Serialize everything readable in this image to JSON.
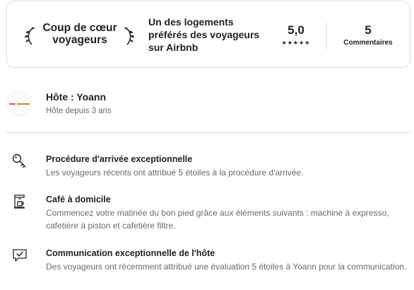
{
  "guest_favorite": {
    "title": "Coup de cœur voyageurs",
    "description": "Un des logements préférés des voyageurs sur Airbnb",
    "rating": "5,0",
    "stars": "★★★★★",
    "reviews_count": "5",
    "reviews_label": "Commentaires"
  },
  "host": {
    "name": "Hôte : Yoann",
    "since": "Hôte depuis 3 ans"
  },
  "highlights": [
    {
      "icon": "key-icon",
      "title": "Procédure d'arrivée exceptionnelle",
      "description": "Les voyageurs récents ont attribué 5 étoiles à la procédure d'arrivée."
    },
    {
      "icon": "coffee-maker-icon",
      "title": "Café à domicile",
      "description": "Commencez votre matinée du bon pied grâce aux éléments suivants : machine à expresso, cafetière à piston et cafetière filtre."
    },
    {
      "icon": "chat-check-icon",
      "title": "Communication exceptionnelle de l'hôte",
      "description": "Des voyageurs ont récemment attribué une évaluation 5 étoiles à Yoann pour la communication."
    }
  ],
  "colors": {
    "text_primary": "#222222",
    "text_secondary": "#6a6a6a",
    "border": "#dddddd"
  }
}
